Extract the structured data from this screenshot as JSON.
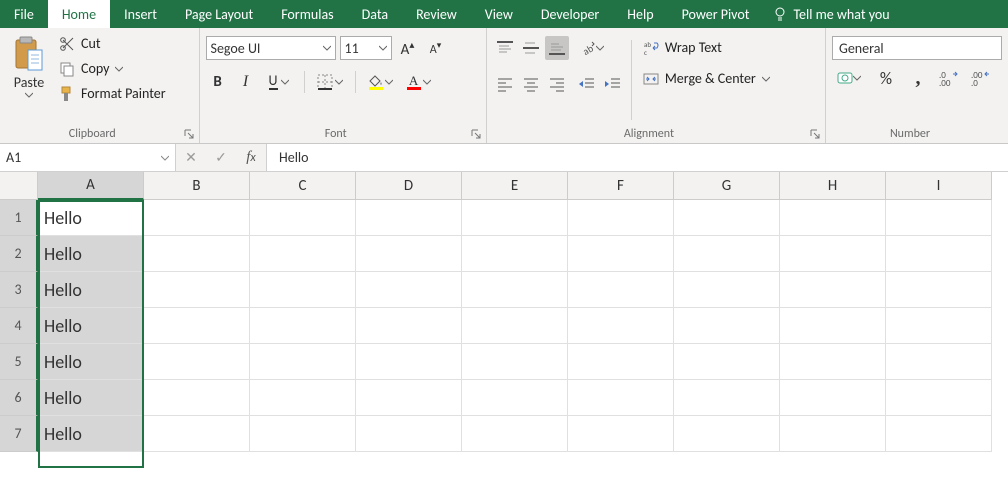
{
  "tabs": {
    "items": [
      "File",
      "Home",
      "Insert",
      "Page Layout",
      "Formulas",
      "Data",
      "Review",
      "View",
      "Developer",
      "Help",
      "Power Pivot"
    ],
    "active": "Home",
    "tell_me": "Tell me what you"
  },
  "clipboard": {
    "paste": "Paste",
    "cut": "Cut",
    "copy": "Copy",
    "format_painter": "Format Painter",
    "group_label": "Clipboard"
  },
  "font": {
    "name": "Segoe UI",
    "size": "11",
    "bold": "B",
    "italic": "I",
    "underline": "U",
    "group_label": "Font"
  },
  "alignment": {
    "wrap_text": "Wrap Text",
    "merge_center": "Merge & Center",
    "group_label": "Alignment"
  },
  "number": {
    "format": "General",
    "percent": "%",
    "comma": ",",
    "group_label": "Number"
  },
  "formula_bar": {
    "name_box": "A1",
    "value": "Hello"
  },
  "grid": {
    "columns": [
      "A",
      "B",
      "C",
      "D",
      "E",
      "F",
      "G",
      "H",
      "I"
    ],
    "rows": [
      "1",
      "2",
      "3",
      "4",
      "5",
      "6",
      "7"
    ],
    "data": {
      "A1": "Hello",
      "A2": "Hello",
      "A3": "Hello",
      "A4": "Hello",
      "A5": "Hello",
      "A6": "Hello",
      "A7": "Hello"
    },
    "selected_column": "A",
    "active_cell": "A1"
  }
}
